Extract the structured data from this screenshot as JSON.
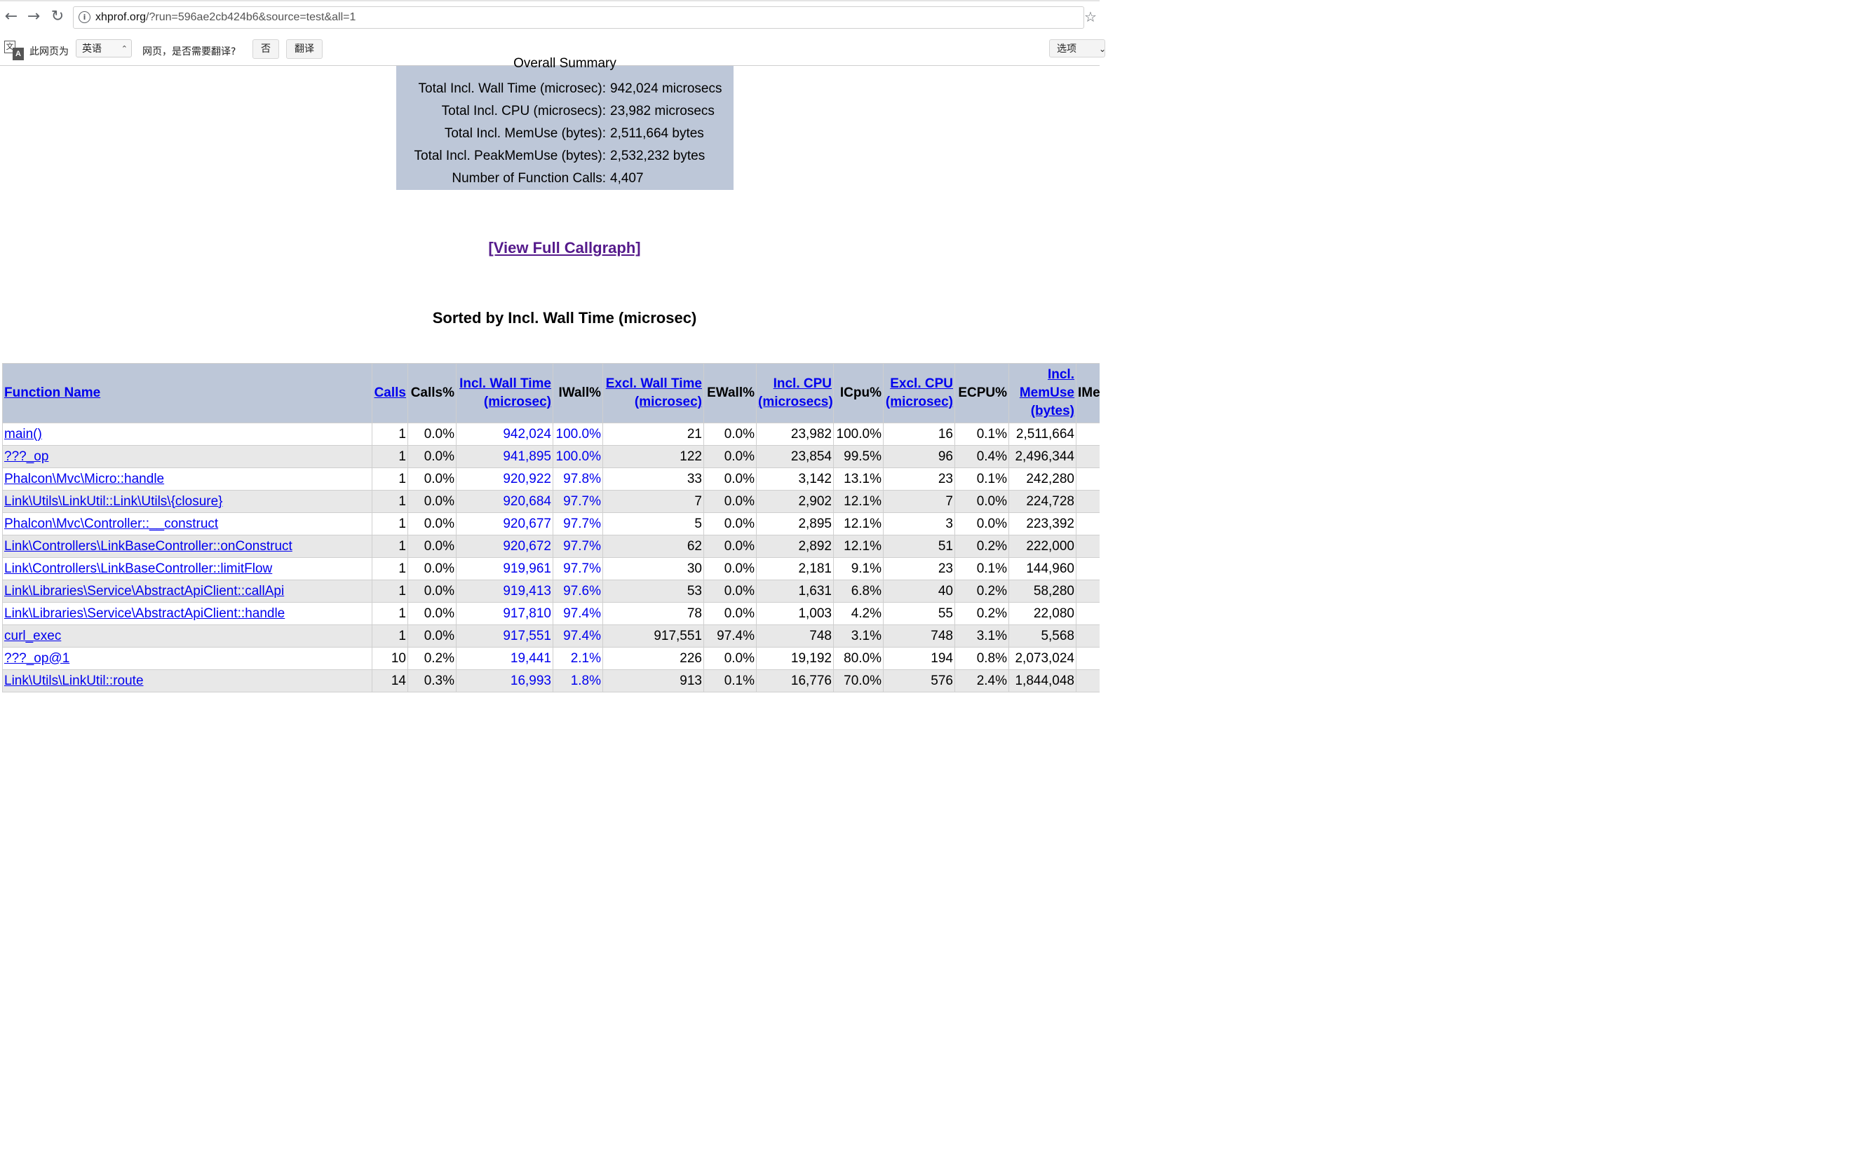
{
  "browser": {
    "url_host": "xhprof.org",
    "url_path": "/?run=596ae2cb424b6&source=test&all=1",
    "back_icon": "back-arrow-icon",
    "forward_icon": "forward-arrow-icon",
    "reload_icon": "reload-icon",
    "star_icon": "bookmark-star-icon"
  },
  "translate_bar": {
    "prefix": "此网页为",
    "language": "英语",
    "question": "网页，是否需要翻译?",
    "no_label": "否",
    "translate_label": "翻译",
    "options_label": "选项"
  },
  "summary": {
    "title": "Overall Summary",
    "rows": [
      {
        "label": "Total Incl. Wall Time (microsec):",
        "value": "942,024 microsecs"
      },
      {
        "label": "Total Incl. CPU (microsecs):",
        "value": "23,982 microsecs"
      },
      {
        "label": "Total Incl. MemUse (bytes):",
        "value": "2,511,664 bytes"
      },
      {
        "label": "Total Incl. PeakMemUse (bytes):",
        "value": "2,532,232 bytes"
      },
      {
        "label": "Number of Function Calls:",
        "value": "4,407"
      }
    ]
  },
  "callgraph_link": "[View Full Callgraph]",
  "sorted_heading": "Sorted by Incl. Wall Time (microsec)",
  "table": {
    "headers": {
      "function_name": "Function Name",
      "calls": "Calls",
      "calls_pct": "Calls%",
      "incl_wall": "Incl. Wall Time (microsec)",
      "iwall_pct": "IWall%",
      "excl_wall": "Excl. Wall Time (microsec)",
      "ewall_pct": "EWall%",
      "incl_cpu": "Incl. CPU (microsecs)",
      "icpu_pct": "ICpu%",
      "excl_cpu": "Excl. CPU (microsec)",
      "ecpu_pct": "ECPU%",
      "incl_memuse": "Incl. MemUse (bytes)",
      "imem_pct": "IMemUse%"
    },
    "rows": [
      [
        "main()",
        "1",
        "0.0%",
        "942,024",
        "100.0%",
        "21",
        "0.0%",
        "23,982",
        "100.0%",
        "16",
        "0.1%",
        "2,511,664"
      ],
      [
        "???_op",
        "1",
        "0.0%",
        "941,895",
        "100.0%",
        "122",
        "0.0%",
        "23,854",
        "99.5%",
        "96",
        "0.4%",
        "2,496,344"
      ],
      [
        "Phalcon\\Mvc\\Micro::handle",
        "1",
        "0.0%",
        "920,922",
        "97.8%",
        "33",
        "0.0%",
        "3,142",
        "13.1%",
        "23",
        "0.1%",
        "242,280"
      ],
      [
        "Link\\Utils\\LinkUtil::Link\\Utils\\{closure}",
        "1",
        "0.0%",
        "920,684",
        "97.7%",
        "7",
        "0.0%",
        "2,902",
        "12.1%",
        "7",
        "0.0%",
        "224,728"
      ],
      [
        "Phalcon\\Mvc\\Controller::__construct",
        "1",
        "0.0%",
        "920,677",
        "97.7%",
        "5",
        "0.0%",
        "2,895",
        "12.1%",
        "3",
        "0.0%",
        "223,392"
      ],
      [
        "Link\\Controllers\\LinkBaseController::onConstruct",
        "1",
        "0.0%",
        "920,672",
        "97.7%",
        "62",
        "0.0%",
        "2,892",
        "12.1%",
        "51",
        "0.2%",
        "222,000"
      ],
      [
        "Link\\Controllers\\LinkBaseController::limitFlow",
        "1",
        "0.0%",
        "919,961",
        "97.7%",
        "30",
        "0.0%",
        "2,181",
        "9.1%",
        "23",
        "0.1%",
        "144,960"
      ],
      [
        "Link\\Libraries\\Service\\AbstractApiClient::callApi",
        "1",
        "0.0%",
        "919,413",
        "97.6%",
        "53",
        "0.0%",
        "1,631",
        "6.8%",
        "40",
        "0.2%",
        "58,280"
      ],
      [
        "Link\\Libraries\\Service\\AbstractApiClient::handle",
        "1",
        "0.0%",
        "917,810",
        "97.4%",
        "78",
        "0.0%",
        "1,003",
        "4.2%",
        "55",
        "0.2%",
        "22,080"
      ],
      [
        "curl_exec",
        "1",
        "0.0%",
        "917,551",
        "97.4%",
        "917,551",
        "97.4%",
        "748",
        "3.1%",
        "748",
        "3.1%",
        "5,568"
      ],
      [
        "???_op@1",
        "10",
        "0.2%",
        "19,441",
        "2.1%",
        "226",
        "0.0%",
        "19,192",
        "80.0%",
        "194",
        "0.8%",
        "2,073,024"
      ],
      [
        "Link\\Utils\\LinkUtil::route",
        "14",
        "0.3%",
        "16,993",
        "1.8%",
        "913",
        "0.1%",
        "16,776",
        "70.0%",
        "576",
        "2.4%",
        "1,844,048"
      ]
    ]
  }
}
